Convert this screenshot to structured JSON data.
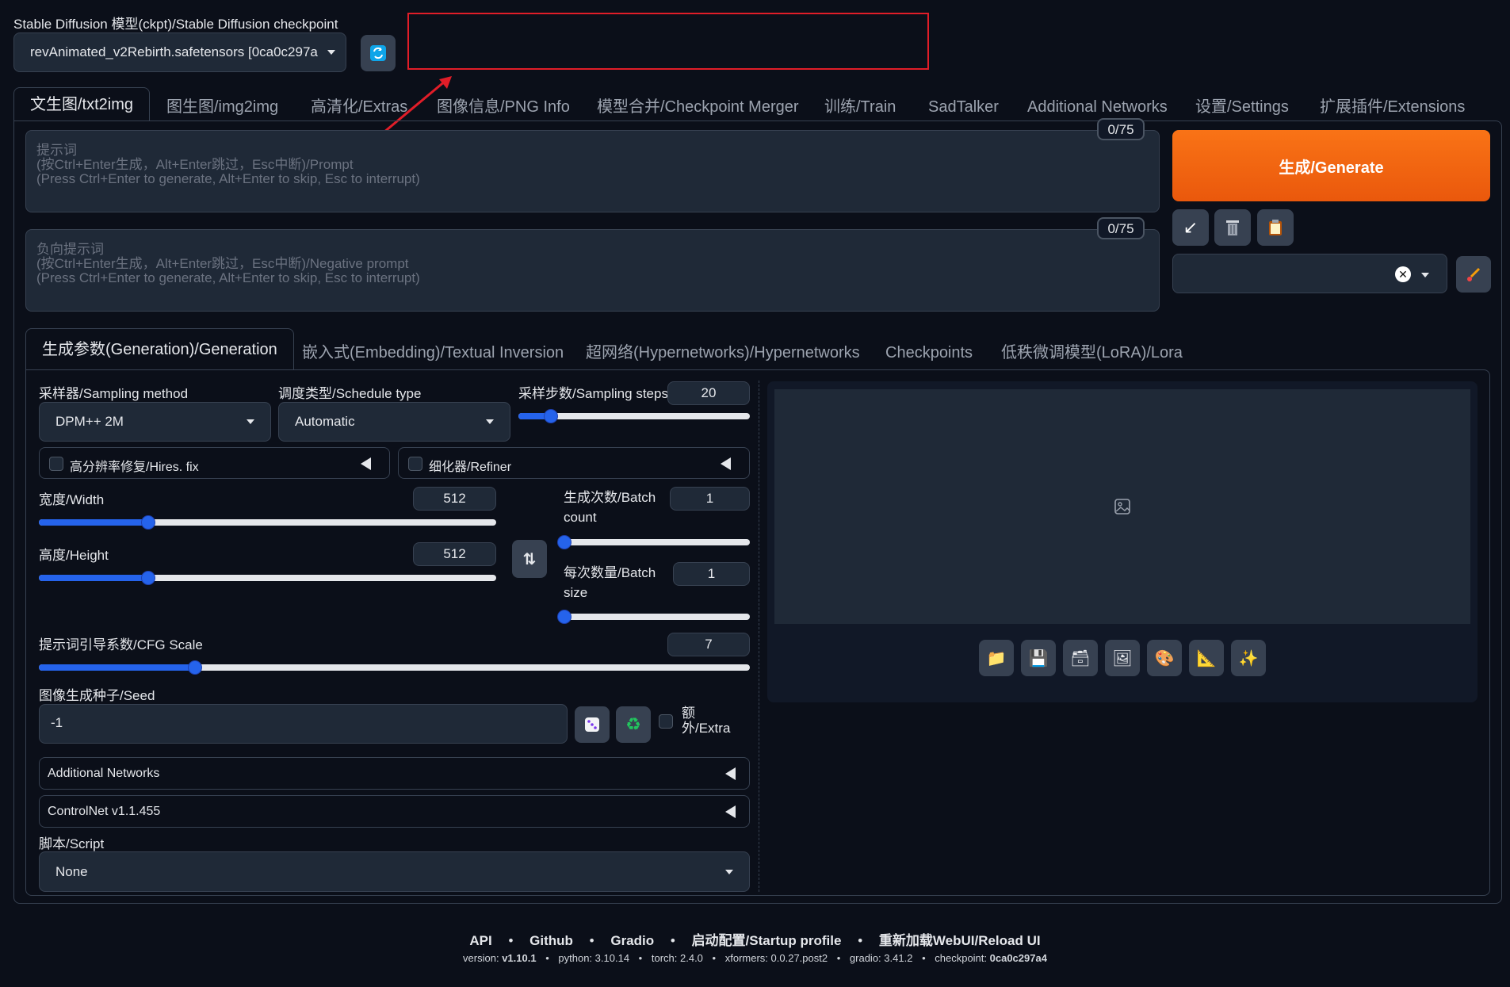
{
  "checkpoint": {
    "label": "Stable Diffusion 模型(ckpt)/Stable Diffusion checkpoint",
    "value": "revAnimated_v2Rebirth.safetensors [0ca0c297a"
  },
  "tabs": [
    "文生图/txt2img",
    "图生图/img2img",
    "高清化/Extras",
    "图像信息/PNG Info",
    "模型合并/Checkpoint Merger",
    "训练/Train",
    "SadTalker",
    "Additional Networks",
    "设置/Settings",
    "扩展插件/Extensions"
  ],
  "prompt": {
    "counter": "0/75",
    "placeholder_1": "提示词",
    "placeholder_2": "(按Ctrl+Enter生成，Alt+Enter跳过，Esc中断)/Prompt",
    "placeholder_3": "(Press Ctrl+Enter to generate, Alt+Enter to skip, Esc to interrupt)"
  },
  "negative_prompt": {
    "counter": "0/75",
    "placeholder_1": "负向提示词",
    "placeholder_2": "(按Ctrl+Enter生成，Alt+Enter跳过，Esc中断)/Negative prompt",
    "placeholder_3": "(Press Ctrl+Enter to generate, Alt+Enter to skip, Esc to interrupt)"
  },
  "generate": {
    "label": "生成/Generate"
  },
  "subtabs": [
    "生成参数(Generation)/Generation",
    "嵌入式(Embedding)/Textual Inversion",
    "超网络(Hypernetworks)/Hypernetworks",
    "Checkpoints",
    "低秩微调模型(LoRA)/Lora"
  ],
  "params": {
    "sampler_label": "采样器/Sampling method",
    "sampler_value": "DPM++ 2M",
    "schedule_label": "调度类型/Schedule type",
    "schedule_value": "Automatic",
    "steps_label": "采样步数/Sampling steps",
    "steps_value": "20",
    "steps_fraction": 0.14,
    "hires_label": "高分辨率修复/Hires. fix",
    "refiner_label": "细化器/Refiner",
    "width_label": "宽度/Width",
    "width_value": "512",
    "width_fraction": 0.24,
    "height_label": "高度/Height",
    "height_value": "512",
    "height_fraction": 0.24,
    "batch_count_label_1": "生成次数/Batch",
    "batch_count_label_2": "count",
    "batch_count_value": "1",
    "batch_size_label_1": "每次数量/Batch",
    "batch_size_label_2": "size",
    "batch_size_value": "1",
    "cfg_label": "提示词引导系数/CFG Scale",
    "cfg_value": "7",
    "cfg_fraction": 0.22,
    "seed_label": "图像生成种子/Seed",
    "seed_value": "-1",
    "extra_label_1": "额",
    "extra_label_2": "外/Extra",
    "additional_networks": "Additional Networks",
    "controlnet": "ControlNet v1.1.455",
    "script_label": "脚本/Script",
    "script_value": "None"
  },
  "footer": {
    "links": [
      "API",
      "Github",
      "Gradio",
      "启动配置/Startup profile",
      "重新加载WebUI/Reload UI"
    ],
    "version_label": "version:",
    "version": "v1.10.1",
    "python_label": "python:",
    "python": "3.10.14",
    "torch_label": "torch:",
    "torch": "2.4.0",
    "xformers_label": "xformers:",
    "xformers": "0.0.27.post2",
    "gradio_label": "gradio:",
    "gradio": "3.41.2",
    "checkpoint_label": "checkpoint:",
    "checkpoint": "0ca0c297a4"
  },
  "colors": {
    "accent": "#ea580c",
    "slider": "#2563eb",
    "annotation": "#e11d28"
  }
}
